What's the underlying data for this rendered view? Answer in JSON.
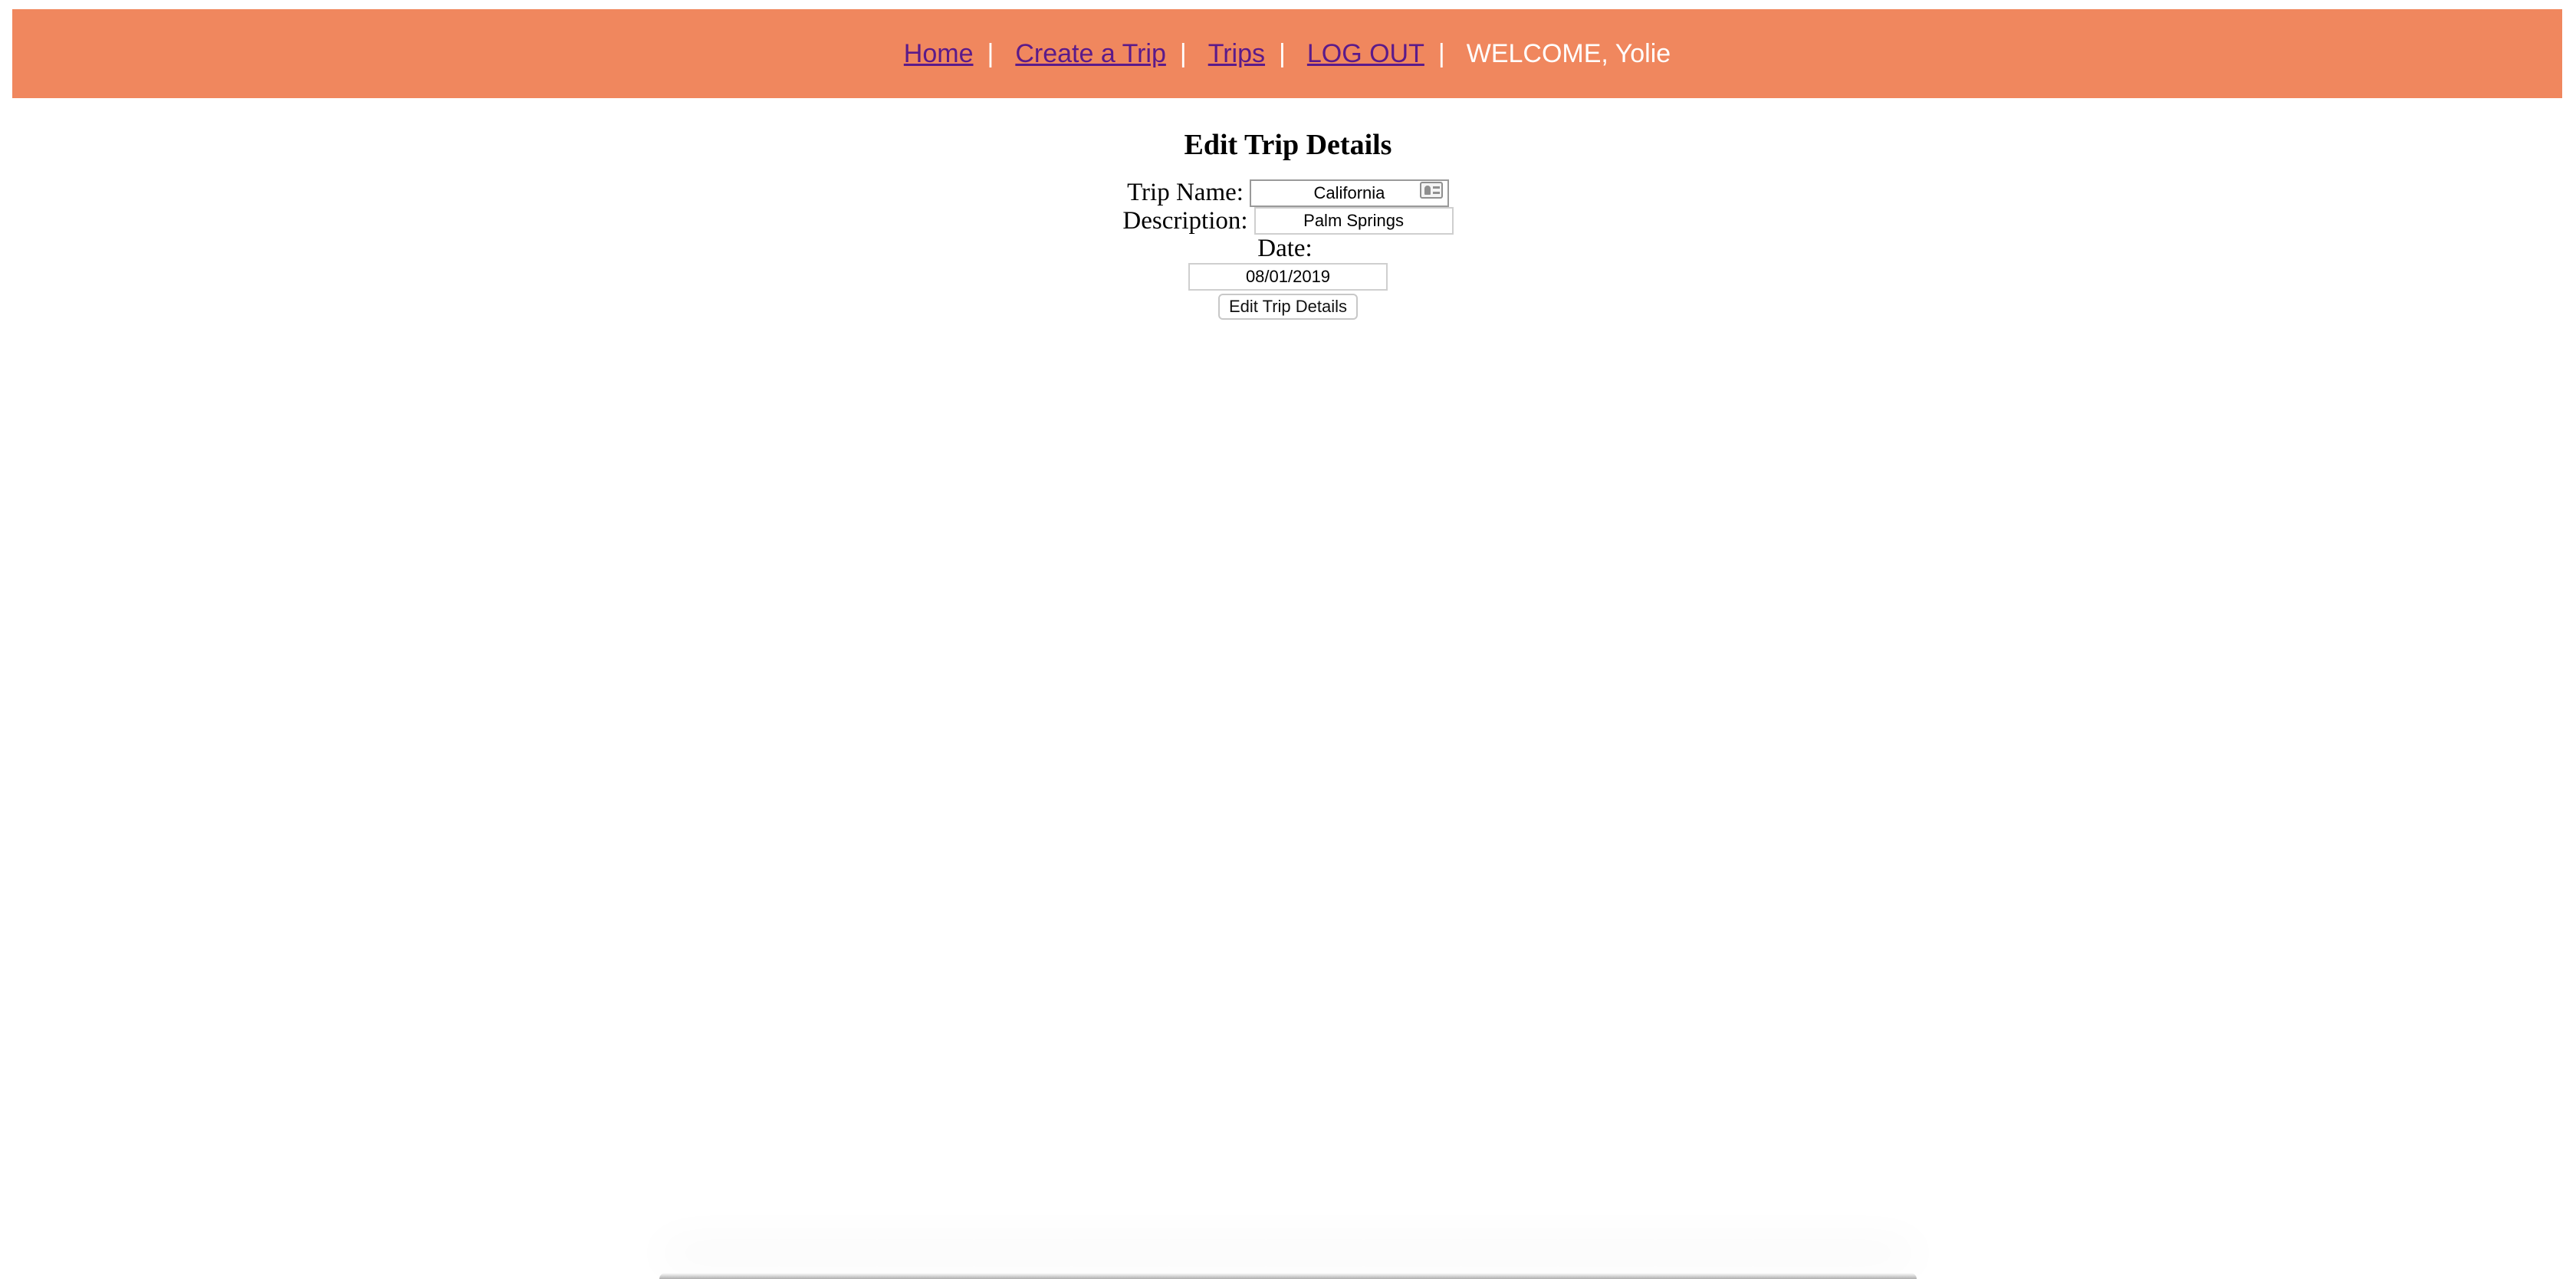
{
  "nav": {
    "home": "Home",
    "create_trip": "Create a Trip",
    "trips": "Trips",
    "logout": "LOG OUT",
    "separator": "|",
    "welcome": "WELCOME, Yolie"
  },
  "page": {
    "title": "Edit Trip Details"
  },
  "form": {
    "trip_name_label": "Trip Name:",
    "trip_name_value": "California",
    "description_label": "Description:",
    "description_value": "Palm Springs",
    "date_label": "Date:",
    "date_value": "08/01/2019",
    "submit_label": "Edit Trip Details"
  },
  "colors": {
    "navbar_bg": "#f0875e",
    "link": "#5b1a8a"
  },
  "icons": {
    "autofill": "contact-card-icon"
  }
}
